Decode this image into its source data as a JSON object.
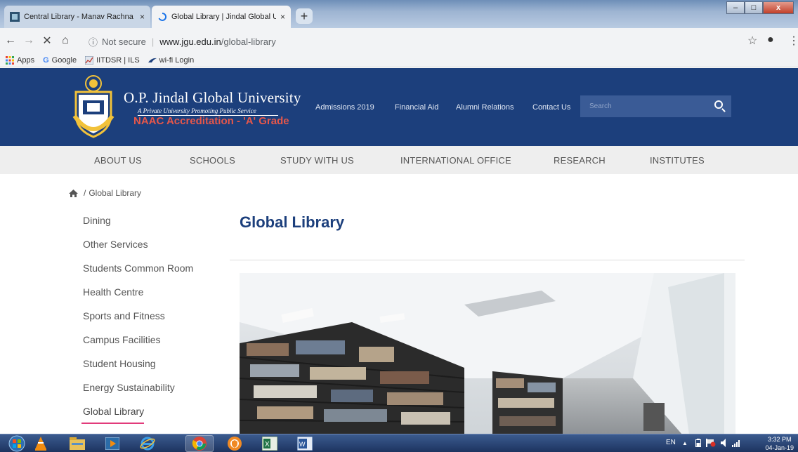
{
  "browser": {
    "tabs": [
      {
        "title": "Central Library - Manav Rachna Vi",
        "close": "×",
        "icon": "library-favicon"
      },
      {
        "title": "Global Library | Jindal Global Uni",
        "close": "×",
        "icon": "loading-spinner-icon"
      }
    ],
    "new_tab": "+",
    "window_controls": {
      "minimize": "–",
      "maximize": "□",
      "close": "x"
    },
    "nav": {
      "back": "←",
      "forward": "→",
      "stop": "✕",
      "home": "⌂"
    },
    "address": {
      "security_icon": "ⓘ",
      "security_label": "Not secure",
      "separator": "|",
      "domain": "www.jgu.edu.in",
      "path": "/global-library"
    },
    "star": "☆",
    "profile": "●",
    "menu": "⋮",
    "bookmarks": [
      {
        "label": "Apps",
        "icon": "apps-grid-icon"
      },
      {
        "label": "Google",
        "icon": "google-icon"
      },
      {
        "label": "IITDSR | ILS",
        "icon": "chart-icon"
      },
      {
        "label": "wi-fi Login",
        "icon": "bird-icon"
      }
    ]
  },
  "site": {
    "name": "O.P. Jindal Global University",
    "tagline": "A Private University Promoting Public Service",
    "accreditation": "NAAC Accreditation - 'A' Grade",
    "top_links": [
      "Admissions 2019",
      "Financial Aid",
      "Alumni Relations",
      "Contact Us"
    ],
    "search_placeholder": "Search",
    "main_nav": [
      "ABOUT US",
      "SCHOOLS",
      "STUDY WITH US",
      "INTERNATIONAL OFFICE",
      "RESEARCH",
      "INSTITUTES"
    ],
    "colors": {
      "header": "#1c3f7c",
      "accent": "#e23b7b",
      "naac": "#e6574a"
    }
  },
  "breadcrumb": {
    "separator": "/",
    "current": "Global Library"
  },
  "sidebar": [
    "Dining",
    "Other Services",
    "Students Common Room",
    "Health Centre",
    "Sports and Fitness",
    "Campus Facilities",
    "Student Housing",
    "Energy Sustainability",
    "Global Library"
  ],
  "active_sidebar": "Global Library",
  "page_title": "Global Library",
  "taskbar": {
    "language": "EN",
    "tray_up": "▲",
    "time": "3:32 PM",
    "date": "04-Jan-19",
    "apps": [
      "start-orb-icon",
      "vlc-icon",
      "file-explorer-icon",
      "media-player-icon",
      "internet-explorer-icon",
      "chrome-icon",
      "shield-app-icon",
      "excel-icon",
      "word-icon"
    ]
  }
}
